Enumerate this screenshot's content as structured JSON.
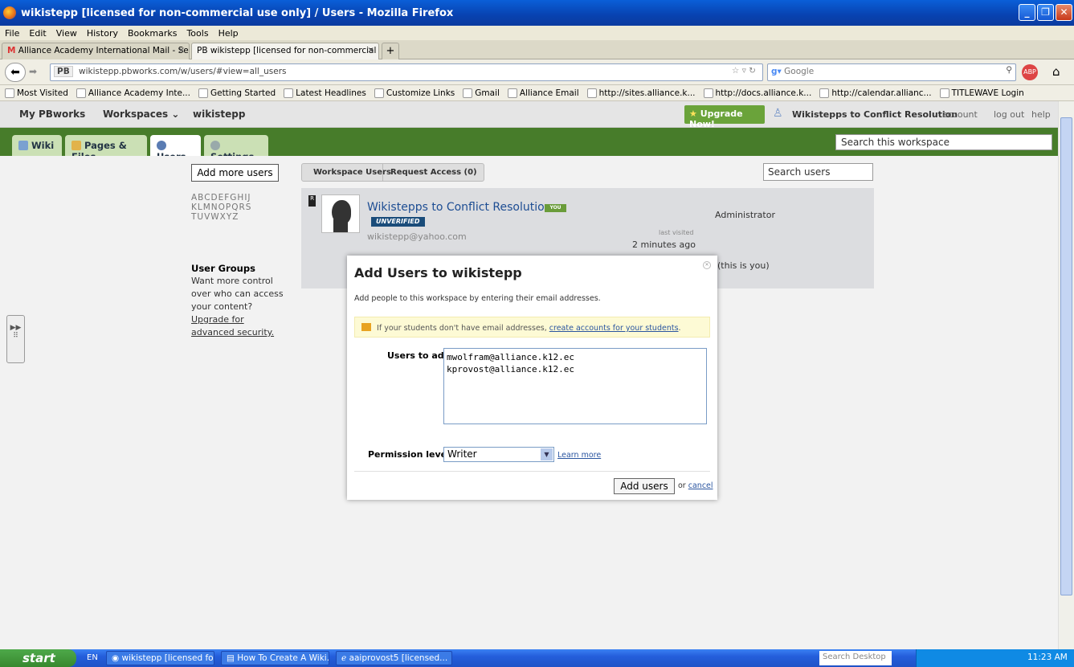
{
  "window": {
    "title": "wikistepp [licensed for non-commercial use only] / Users - Mozilla Firefox"
  },
  "menu": [
    "File",
    "Edit",
    "View",
    "History",
    "Bookmarks",
    "Tools",
    "Help"
  ],
  "browser_tabs": [
    {
      "label": "Alliance Academy International Mail - Sea..."
    },
    {
      "label": "PB wikistepp [licensed for non-commercial us..."
    }
  ],
  "address": {
    "url": "wikistepp.pbworks.com/w/users/#view=all_users",
    "search_placeholder": "Google"
  },
  "bookmarks": [
    "Most Visited",
    "Alliance Academy Inte...",
    "Getting Started",
    "Latest Headlines",
    "Customize Links",
    "Gmail",
    "Alliance Email",
    "http://sites.alliance.k...",
    "http://docs.alliance.k...",
    "http://calendar.allianc...",
    "TITLEWAVE Login"
  ],
  "pb_header": {
    "my_pbworks": "My PBworks",
    "workspaces": "Workspaces",
    "workspace_name": "wikistepp",
    "upgrade": "Upgrade Now!",
    "user": "Wikistepps to Conflict Resolution",
    "account": "account",
    "logout": "log out",
    "help": "help"
  },
  "ws_tabs": [
    "Wiki",
    "Pages & Files",
    "Users",
    "Settings"
  ],
  "ws_search_placeholder": "Search this workspace",
  "users_page": {
    "add_more_users": "Add more users",
    "alphabet": [
      "ABCDEFGHIJ",
      "KLMNOPQRS",
      "TUVWXYZ"
    ],
    "user_groups_title": "User Groups",
    "user_groups_text": "Want more control over who can access your content?",
    "user_groups_link": "Upgrade for advanced security.",
    "tab_workspace_users": "Workspace Users",
    "tab_request_access": "Request Access (0)",
    "search_users_placeholder": "Search users",
    "user": {
      "name": "Wikistepps to Conflict Resolution",
      "you_badge": "YOU",
      "status": "UNVERIFIED",
      "email": "wikistepp@yahoo.com",
      "last_visited_label": "last visited",
      "last_visited": "2 minutes ago",
      "role": "Administrator",
      "this_is_you": "(this is you)"
    }
  },
  "modal": {
    "title": "Add Users to wikistepp",
    "description": "Add people to this workspace by entering their email addresses.",
    "note_text": "If your students don't have email addresses, ",
    "note_link": "create accounts for your students",
    "users_label": "Users to add",
    "users_value": "mwolfram@alliance.k12.ec\nkprovost@alliance.k12.ec",
    "permission_label": "Permission level",
    "permission_value": "Writer",
    "learn_more": "Learn more",
    "add_button": "Add users",
    "or": "or",
    "cancel": "cancel"
  },
  "taskbar": {
    "start": "start",
    "lang": "EN",
    "tasks": [
      "wikistepp [licensed fo...",
      "How To Create A Wiki...",
      "aaiprovost5 [licensed..."
    ],
    "desktop_search": "Search Desktop",
    "time": "11:23 AM"
  }
}
